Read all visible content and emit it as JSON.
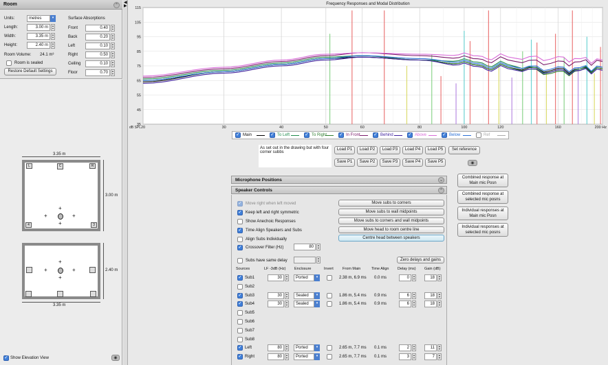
{
  "room_panel": {
    "title": "Room",
    "units_label": "Units:",
    "units_value": "metres",
    "length_label": "Length:",
    "length_value": "3.00 m",
    "width_label": "Width:",
    "width_value": "3.35 m",
    "height_label": "Height:",
    "height_value": "2.40 m",
    "volume_label": "Room Volume:",
    "volume_value": "24.1 m³",
    "sealed_label": "Room is sealed",
    "restore_button": "Restore Default Settings",
    "absorptions_title": "Surface Absorptions",
    "absorptions": [
      {
        "label": "Front",
        "value": "0.40"
      },
      {
        "label": "Back",
        "value": "0.20"
      },
      {
        "label": "Left",
        "value": "0.10"
      },
      {
        "label": "Right",
        "value": "0.50"
      },
      {
        "label": "Ceiling",
        "value": "0.10"
      },
      {
        "label": "Floor",
        "value": "0.70"
      }
    ]
  },
  "drawing": {
    "plan_width_label": "3.35 m",
    "plan_depth_label": "3.00 m",
    "elev_height_label": "2.40 m",
    "elev_width_label": "3.35 m",
    "corner_labels": [
      "L",
      "R",
      "4",
      "3"
    ],
    "centre_label": "C",
    "show_elevation_label": "Show Elevation View"
  },
  "chart": {
    "title": "Frequency Responses and Modal Distribution",
    "ylabel": "dB SPL",
    "y_ticks": [
      "115",
      "105",
      "95",
      "85",
      "75",
      "65",
      "55",
      "45",
      "35"
    ],
    "x_ticks": [
      "20",
      "30",
      "40",
      "50",
      "60",
      "80",
      "100",
      "120",
      "160",
      "200 Hz"
    ]
  },
  "chart_data": {
    "type": "line",
    "title": "Frequency Responses and Modal Distribution",
    "xlabel": "",
    "ylabel": "dB SPL",
    "x_scale": "log",
    "xlim": [
      20,
      200
    ],
    "ylim": [
      35,
      115
    ],
    "x": [
      20,
      30,
      40,
      50,
      60,
      80,
      100,
      120,
      160,
      200
    ],
    "series": [
      {
        "name": "Main",
        "color": "#000000",
        "values": [
          64,
          71,
          76,
          80,
          81,
          79,
          76,
          74,
          72,
          73
        ]
      },
      {
        "name": "To Left",
        "color": "#1e8a4a",
        "values": [
          66,
          72,
          77,
          81,
          82,
          79,
          78,
          76,
          71,
          74
        ]
      },
      {
        "name": "To Right",
        "color": "#2e7d2e",
        "values": [
          65,
          71,
          76,
          80,
          82,
          79,
          76,
          74,
          70,
          73
        ]
      },
      {
        "name": "In Front",
        "color": "#7a1a6a",
        "values": [
          67,
          73,
          78,
          82,
          84,
          82,
          80,
          79,
          77,
          78
        ]
      },
      {
        "name": "Behind",
        "color": "#3d1f9c",
        "values": [
          63,
          70,
          75,
          79,
          81,
          79,
          75,
          73,
          71,
          72
        ]
      },
      {
        "name": "Above",
        "color": "#d86ad8",
        "values": [
          68,
          74,
          79,
          83,
          84,
          83,
          82,
          81,
          80,
          79
        ]
      },
      {
        "name": "Below",
        "color": "#2a6fd6",
        "values": [
          65,
          71,
          76,
          80,
          82,
          80,
          77,
          75,
          73,
          74
        ]
      }
    ],
    "modes": [
      {
        "freq": 51,
        "level": 97,
        "color": "#7fcf7f"
      },
      {
        "freq": 57,
        "level": 113,
        "color": "#e96a6a"
      },
      {
        "freq": 67,
        "level": 113,
        "color": "#e96a6a"
      },
      {
        "freq": 75,
        "level": 75,
        "color": "#d8d860"
      },
      {
        "freq": 85,
        "level": 83,
        "color": "#7fcf7f"
      },
      {
        "freq": 89,
        "level": 68,
        "color": "#e96a6a"
      },
      {
        "freq": 96,
        "level": 63,
        "color": "#b27fe0"
      },
      {
        "freq": 100,
        "level": 99,
        "color": "#60d0d0"
      },
      {
        "freq": 103,
        "level": 92,
        "color": "#e96a6a"
      },
      {
        "freq": 113,
        "level": 113,
        "color": "#e96a6a"
      },
      {
        "freq": 119,
        "level": 75,
        "color": "#d8d860"
      },
      {
        "freq": 127,
        "level": 67,
        "color": "#b27fe0"
      },
      {
        "freq": 134,
        "level": 85,
        "color": "#7fcf7f"
      },
      {
        "freq": 140,
        "level": 93,
        "color": "#60d0d0"
      },
      {
        "freq": 144,
        "level": 91,
        "color": "#e96a6a"
      },
      {
        "freq": 151,
        "level": 70,
        "color": "#d8d860"
      },
      {
        "freq": 158,
        "level": 97,
        "color": "#e96a6a"
      },
      {
        "freq": 165,
        "level": 81,
        "color": "#7fcf7f"
      },
      {
        "freq": 172,
        "level": 113,
        "color": "#e96a6a"
      },
      {
        "freq": 177,
        "level": 74,
        "color": "#b27fe0"
      },
      {
        "freq": 185,
        "level": 95,
        "color": "#60d0d0"
      },
      {
        "freq": 192,
        "level": 70,
        "color": "#d8d860"
      },
      {
        "freq": 198,
        "level": 88,
        "color": "#e96a6a"
      }
    ]
  },
  "legend": [
    {
      "label": "Main",
      "color": "#000000",
      "checked": true
    },
    {
      "label": "To Left",
      "color": "#1e8a4a",
      "checked": true
    },
    {
      "label": "To Right",
      "color": "#2e7d2e",
      "checked": true
    },
    {
      "label": "In Front",
      "color": "#7a1a6a",
      "checked": true
    },
    {
      "label": "Behind",
      "color": "#3d1f9c",
      "checked": true
    },
    {
      "label": "Above",
      "color": "#d86ad8",
      "checked": true
    },
    {
      "label": "Below",
      "color": "#2a6fd6",
      "checked": true
    },
    {
      "label": "Ref",
      "color": "#aaaaaa",
      "checked": false
    }
  ],
  "presets": {
    "description": "As set out in the drawing but with four corner subbs",
    "load": [
      "Load P1",
      "Load P2",
      "Load P3",
      "Load P4",
      "Load P5"
    ],
    "save": [
      "Save P1",
      "Save P2",
      "Save P3",
      "Save P4",
      "Save P5"
    ],
    "set_reference": "Set reference"
  },
  "mic_section": "Microphone Positions",
  "speaker_section": "Speaker Controls",
  "speaker_controls": {
    "opt_move_right": "Move right when left moved",
    "opt_keep_symmetric": "Keep left and right symmetric",
    "opt_show_anechoic": "Show Anechoic Responses",
    "opt_time_align": "Time Align Speakers and Subs",
    "opt_align_subs": "Align Subs Individually",
    "opt_crossover": "Crossover Filter (Hz)",
    "crossover_value": "80",
    "opt_same_delay": "Subs have same delay",
    "btn_move_corners": "Move subs to corners",
    "btn_move_wall_mid": "Move subs to wall midpoints",
    "btn_move_both": "Move subs to corners and wall midpoints",
    "btn_move_head": "Move head to room centre line",
    "btn_centre_head": "Centre head between speakers",
    "btn_zero_delays": "Zero delays and gains"
  },
  "sources_table": {
    "headers": [
      "Sources",
      "LF -3dB (Hz)",
      "Enclosure",
      "Invert",
      "From Main",
      "Time Align",
      "Delay (ms)",
      "Gain (dB)"
    ],
    "rows": [
      {
        "name": "Sub1",
        "checked": true,
        "lf": "30",
        "enclosure": "Ported",
        "from_main": "2.38 m, 6.9 ms",
        "time_align": "0.0 ms",
        "delay": "0",
        "gain": "18"
      },
      {
        "name": "Sub2",
        "checked": false
      },
      {
        "name": "Sub3",
        "checked": true,
        "lf": "30",
        "enclosure": "Sealed",
        "from_main": "1.86 m, 5.4 ms",
        "time_align": "0.9 ms",
        "delay": "6",
        "gain": "18"
      },
      {
        "name": "Sub4",
        "checked": true,
        "lf": "30",
        "enclosure": "Sealed",
        "from_main": "1.86 m, 5.4 ms",
        "time_align": "0.9 ms",
        "delay": "6",
        "gain": "18"
      },
      {
        "name": "Sub5",
        "checked": false
      },
      {
        "name": "Sub6",
        "checked": false
      },
      {
        "name": "Sub7",
        "checked": false
      },
      {
        "name": "Sub8",
        "checked": false
      },
      {
        "name": "Left",
        "checked": true,
        "lf": "80",
        "enclosure": "Ported",
        "from_main": "2.65 m, 7.7 ms",
        "time_align": "0.1 ms",
        "delay": "2",
        "gain": "11"
      },
      {
        "name": "Right",
        "checked": true,
        "lf": "80",
        "enclosure": "Ported",
        "from_main": "2.65 m, 7.7 ms",
        "time_align": "0.1 ms",
        "delay": "3",
        "gain": "7"
      }
    ]
  },
  "right_buttons": [
    "Combined response at Main mic Posn",
    "Combined response at selected mic posns",
    "Individual responses at Main mic Posn",
    "Individual responses at selected mic posns"
  ]
}
